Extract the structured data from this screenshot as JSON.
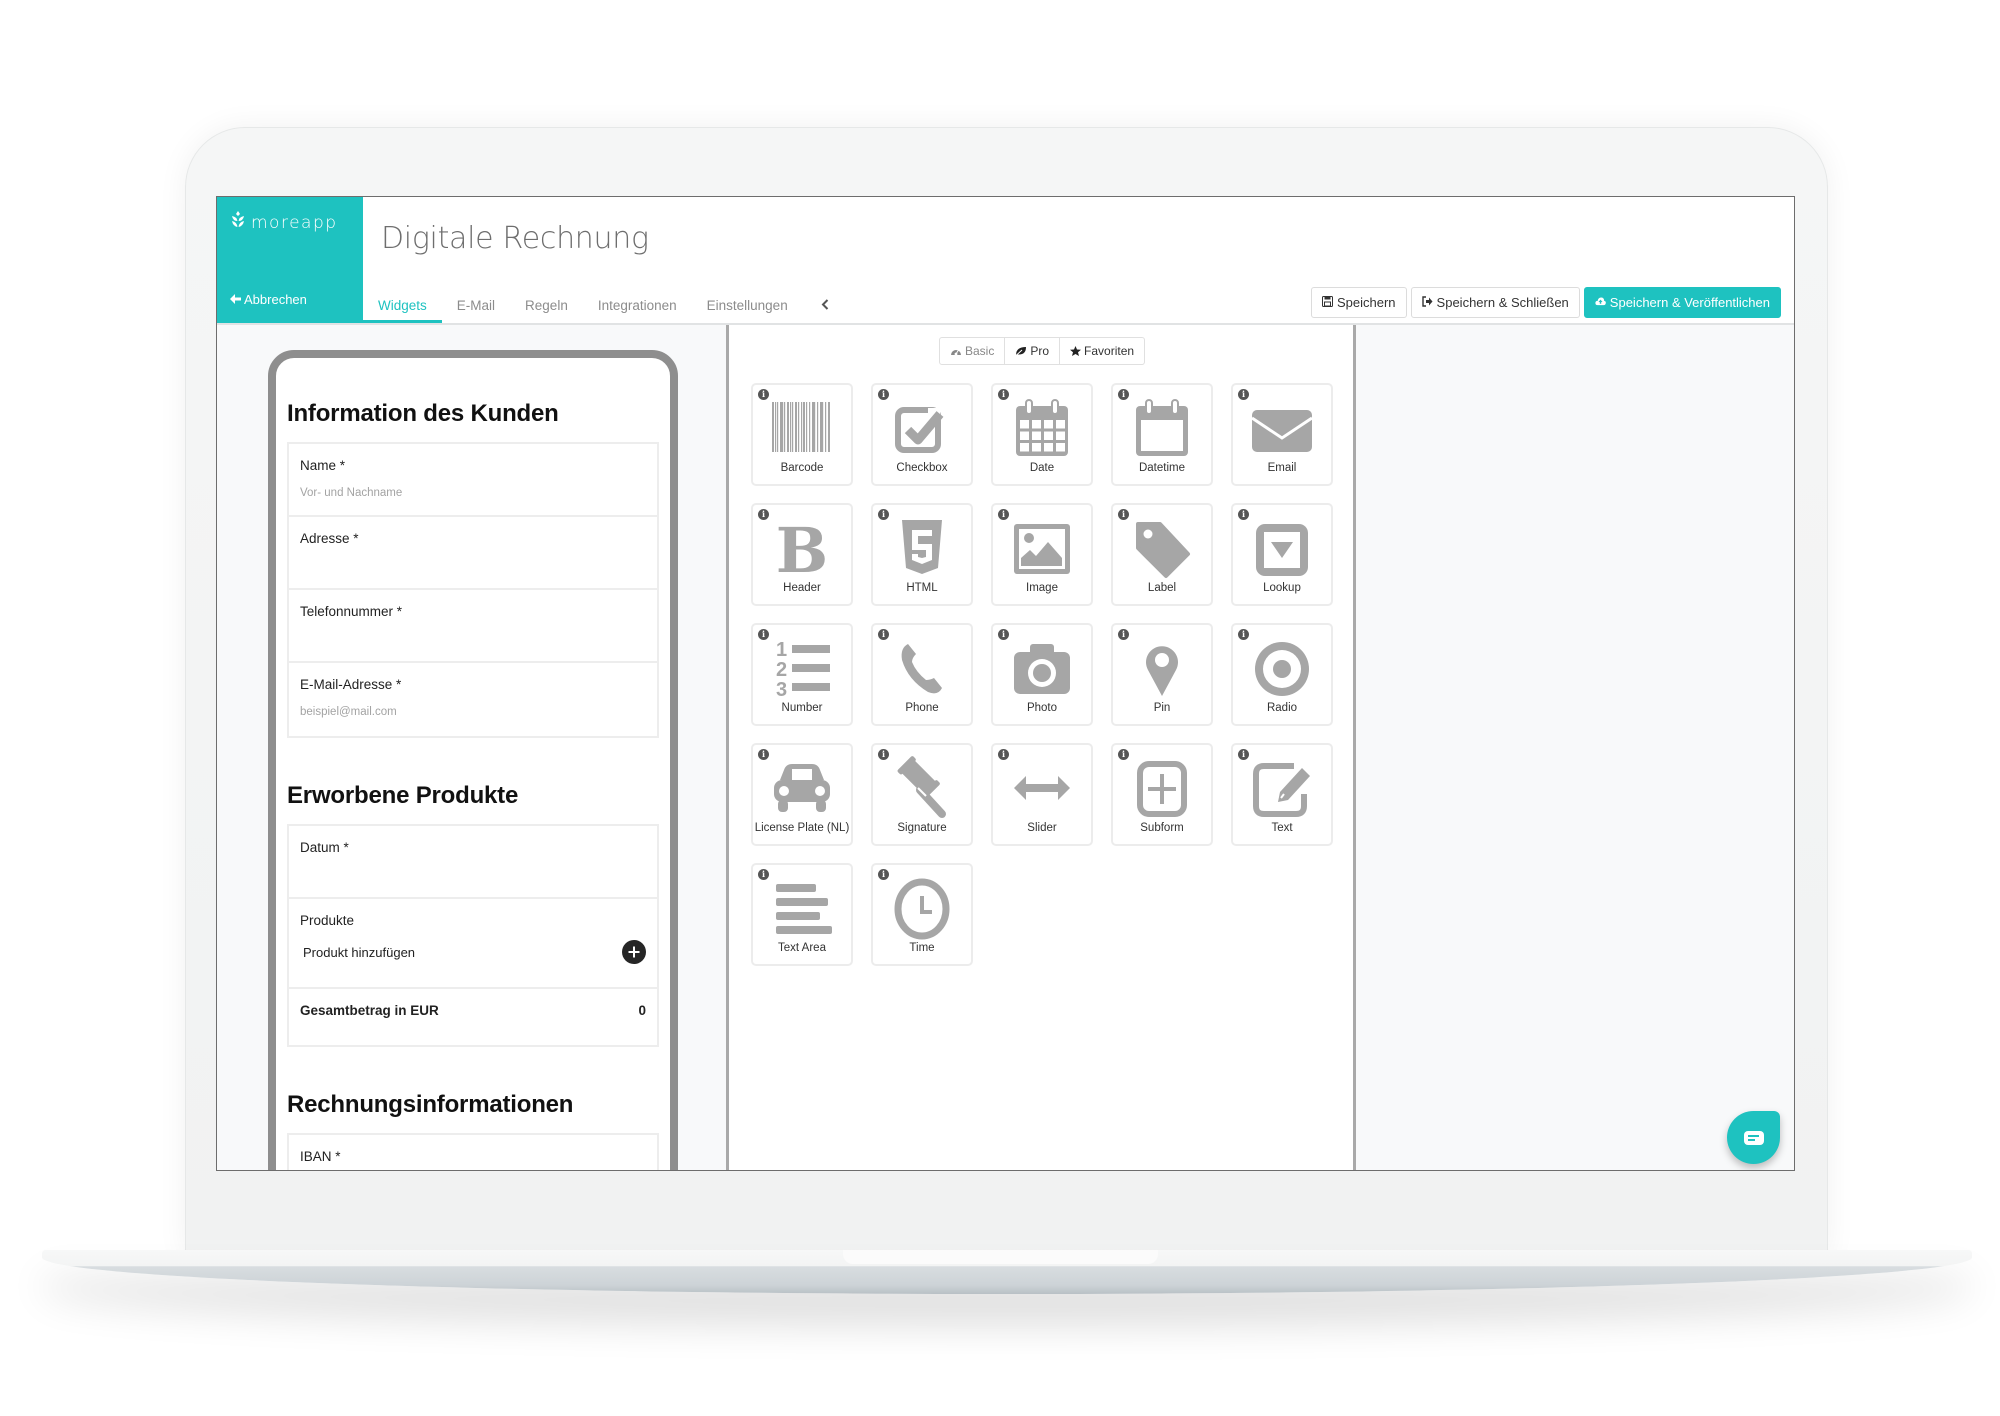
{
  "app": {
    "brand": "moreapp",
    "cancel_label": "Abbrechen",
    "title": "Digitale Rechnung"
  },
  "tabs": [
    {
      "label": "Widgets",
      "active": true
    },
    {
      "label": "E-Mail",
      "active": false
    },
    {
      "label": "Regeln",
      "active": false
    },
    {
      "label": "Integrationen",
      "active": false
    },
    {
      "label": "Einstellungen",
      "active": false
    }
  ],
  "actions": {
    "save": "Speichern",
    "save_close": "Speichern & Schließen",
    "save_publish": "Speichern & Veröffentlichen"
  },
  "colors": {
    "accent": "#1ec2c0",
    "icon_gray": "#a6a6a6"
  },
  "preview": {
    "sections": [
      {
        "title": "Information des Kunden",
        "fields": [
          {
            "label": "Name *",
            "placeholder": "Vor- und Nachname"
          },
          {
            "label": "Adresse *",
            "placeholder": ""
          },
          {
            "label": "Telefonnummer *",
            "placeholder": ""
          },
          {
            "label": "E-Mail-Adresse *",
            "placeholder": "beispiel@mail.com"
          }
        ]
      },
      {
        "title": "Erworbene Produkte",
        "fields": [
          {
            "label": "Datum *"
          },
          {
            "label": "Produkte",
            "action": "Produkt hinzufügen"
          },
          {
            "label": "Gesamtbetrag in EUR",
            "value": "0"
          }
        ]
      },
      {
        "title": "Rechnungsinformationen",
        "fields": [
          {
            "label": "IBAN *"
          }
        ]
      }
    ]
  },
  "widget_panel": {
    "filters": [
      {
        "label": "Basic",
        "icon": "dashboard-icon",
        "active": true
      },
      {
        "label": "Pro",
        "icon": "leaf-icon",
        "active": false
      },
      {
        "label": "Favoriten",
        "icon": "star-icon",
        "active": false
      }
    ],
    "widgets": [
      {
        "label": "Barcode",
        "icon": "barcode-icon"
      },
      {
        "label": "Checkbox",
        "icon": "checkbox-icon"
      },
      {
        "label": "Date",
        "icon": "calendar-grid-icon"
      },
      {
        "label": "Datetime",
        "icon": "calendar-icon"
      },
      {
        "label": "Email",
        "icon": "envelope-icon"
      },
      {
        "label": "Header",
        "icon": "bold-b-icon"
      },
      {
        "label": "HTML",
        "icon": "html5-icon"
      },
      {
        "label": "Image",
        "icon": "image-icon"
      },
      {
        "label": "Label",
        "icon": "tag-icon"
      },
      {
        "label": "Lookup",
        "icon": "dropdown-box-icon"
      },
      {
        "label": "Number",
        "icon": "numbered-list-icon"
      },
      {
        "label": "Phone",
        "icon": "phone-icon"
      },
      {
        "label": "Photo",
        "icon": "camera-icon"
      },
      {
        "label": "Pin",
        "icon": "map-pin-icon"
      },
      {
        "label": "Radio",
        "icon": "radio-icon"
      },
      {
        "label": "License Plate (NL)",
        "icon": "car-icon"
      },
      {
        "label": "Signature",
        "icon": "gavel-icon"
      },
      {
        "label": "Slider",
        "icon": "double-arrow-icon"
      },
      {
        "label": "Subform",
        "icon": "plus-square-icon"
      },
      {
        "label": "Text",
        "icon": "edit-icon"
      },
      {
        "label": "Text Area",
        "icon": "align-left-icon"
      },
      {
        "label": "Time",
        "icon": "clock-icon"
      }
    ]
  }
}
